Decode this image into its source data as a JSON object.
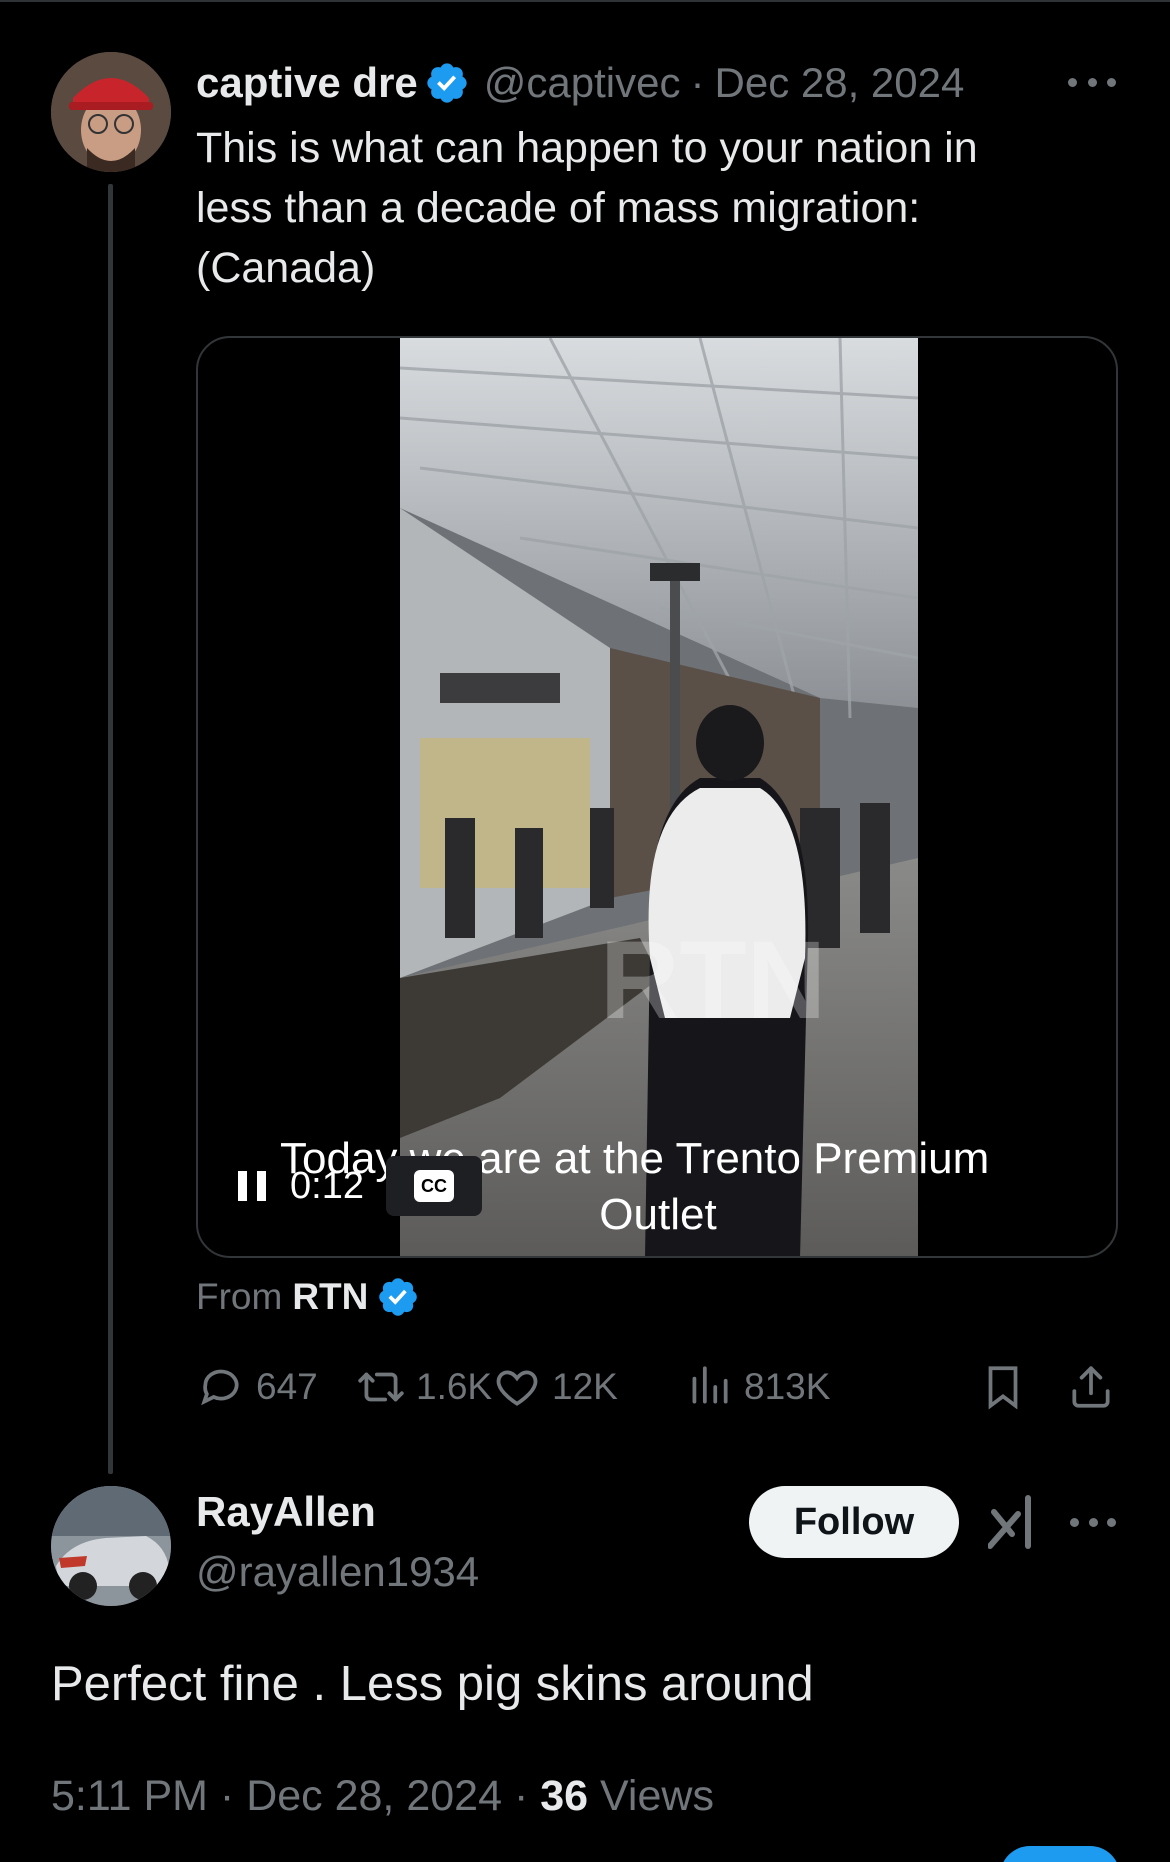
{
  "tweet": {
    "author_name": "captive dre",
    "author_handle": "@captivec",
    "separator": "·",
    "date": "Dec 28, 2024",
    "text_lines": [
      "This is what can happen to your nation in",
      "less than a decade of mass migration:",
      "(Canada)"
    ],
    "video": {
      "time": "0:12",
      "cc_label": "CC",
      "caption_line1": "Today we are at the Trento Premium",
      "caption_line2": "Outlet",
      "watermark": "RTN"
    },
    "from_prefix": "From",
    "from_source": "RTN",
    "stats": {
      "replies": "647",
      "reposts": "1.6K",
      "likes": "12K",
      "views": "813K"
    }
  },
  "reply": {
    "author_name": "RayAllen",
    "author_handle": "@rayallen1934",
    "follow_label": "Follow",
    "text": "Perfect fine . Less pig skins around",
    "time": "5:11 PM",
    "date": "Dec 28, 2024",
    "views_count": "36",
    "views_label": "Views"
  },
  "colors": {
    "background": "#000000",
    "text_primary": "#e7e9ea",
    "text_secondary": "#71767b",
    "verified_blue": "#1d9bf0",
    "border": "#333639"
  },
  "icons": [
    "verified-badge-icon",
    "more-icon",
    "pause-icon",
    "cc-icon",
    "reply-icon",
    "repost-icon",
    "like-icon",
    "views-icon",
    "bookmark-icon",
    "share-icon",
    "grok-icon"
  ]
}
